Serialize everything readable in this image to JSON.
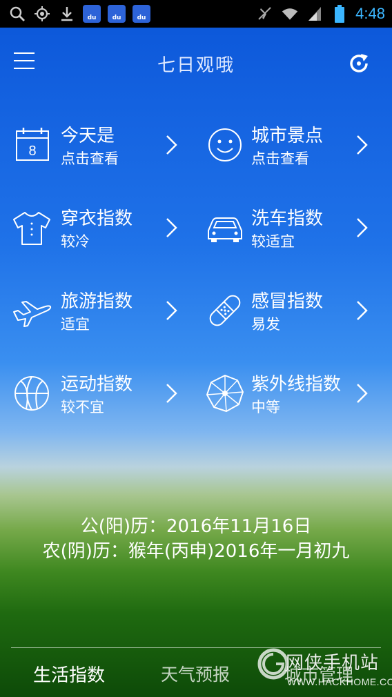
{
  "status_bar": {
    "time": "4:48",
    "left_icons": [
      "search-icon",
      "location-icon",
      "download-icon",
      "baidu-icon",
      "baidu-icon",
      "baidu-icon"
    ],
    "baidu_label": "du",
    "time_color": "#3bb6ff"
  },
  "header": {
    "title": "七日观哦"
  },
  "grid": {
    "items": [
      {
        "name": "今天是",
        "value": "点击查看",
        "icon": "calendar-icon",
        "icon_text": "8"
      },
      {
        "name": "城市景点",
        "value": "点击查看",
        "icon": "smiley-icon"
      },
      {
        "name": "穿衣指数",
        "value": "较冷",
        "icon": "tshirt-icon"
      },
      {
        "name": "洗车指数",
        "value": "较适宜",
        "icon": "car-icon"
      },
      {
        "name": "旅游指数",
        "value": "适宜",
        "icon": "airplane-icon"
      },
      {
        "name": "感冒指数",
        "value": "易发",
        "icon": "bandage-icon"
      },
      {
        "name": "运动指数",
        "value": "较不宜",
        "icon": "basketball-icon"
      },
      {
        "name": "紫外线指数",
        "value": "中等",
        "icon": "umbrella-icon"
      }
    ]
  },
  "dates": {
    "solar": "公(阳)历：2016年11月16日",
    "lunar": "农(阴)历：猴年(丙申)2016年一月初九"
  },
  "nav": {
    "tabs": [
      {
        "label": "生活指数",
        "active": true
      },
      {
        "label": "天气预报",
        "active": false
      },
      {
        "label": "城市管理",
        "active": false
      }
    ]
  },
  "watermark": {
    "title": "网侠手机站",
    "url": "WWW.HACKHOME.COM"
  }
}
